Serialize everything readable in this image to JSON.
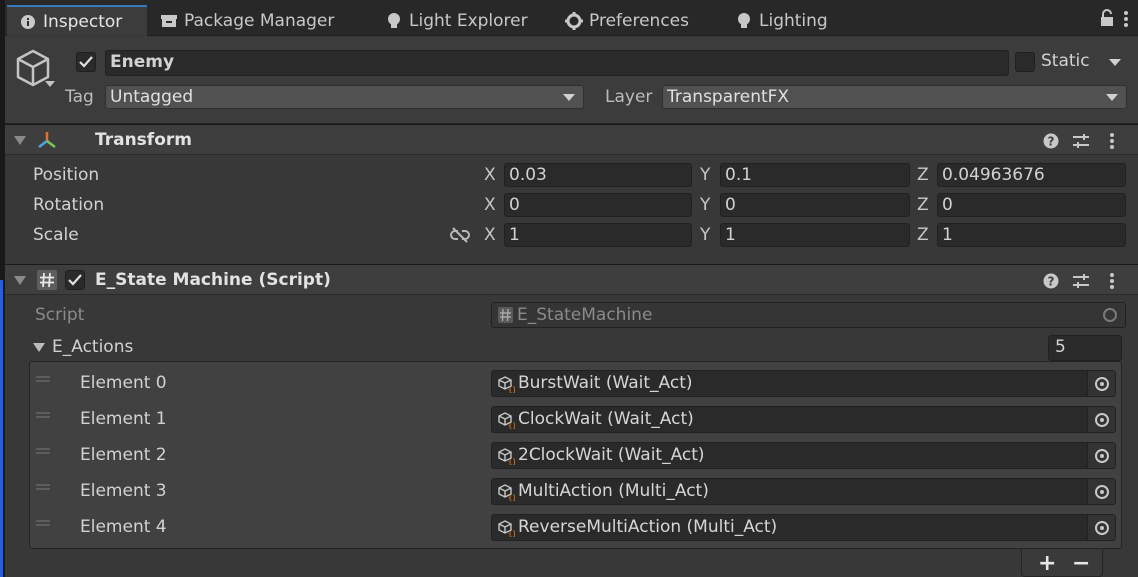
{
  "tabs": [
    {
      "label": "Inspector",
      "icon": "info-icon",
      "active": true
    },
    {
      "label": "Package Manager",
      "icon": "package-icon",
      "active": false
    },
    {
      "label": "Light Explorer",
      "icon": "lightbulb-icon",
      "active": false
    },
    {
      "label": "Preferences",
      "icon": "gear-icon",
      "active": false
    },
    {
      "label": "Lighting",
      "icon": "lightbulb-icon",
      "active": false
    }
  ],
  "gameobject": {
    "active": true,
    "name": "Enemy",
    "static_label": "Static",
    "static_checked": false,
    "tag_label": "Tag",
    "tag_value": "Untagged",
    "layer_label": "Layer",
    "layer_value": "TransparentFX"
  },
  "transform": {
    "title": "Transform",
    "position": {
      "label": "Position",
      "x": "0.03",
      "y": "0.1",
      "z": "0.04963676"
    },
    "rotation": {
      "label": "Rotation",
      "x": "0",
      "y": "0",
      "z": "0"
    },
    "scale": {
      "label": "Scale",
      "x": "1",
      "y": "1",
      "z": "1"
    },
    "axis_x": "X",
    "axis_y": "Y",
    "axis_z": "Z"
  },
  "script_component": {
    "enabled": true,
    "title": "E_State Machine (Script)",
    "script_label": "Script",
    "script_value": "E_StateMachine",
    "list_label": "E_Actions",
    "list_size": "5",
    "elements": [
      {
        "label": "Element 0",
        "value": "BurstWait (Wait_Act)"
      },
      {
        "label": "Element 1",
        "value": "ClockWait (Wait_Act)"
      },
      {
        "label": "Element 2",
        "value": "2ClockWait (Wait_Act)"
      },
      {
        "label": "Element 3",
        "value": "MultiAction (Multi_Act)"
      },
      {
        "label": "Element 4",
        "value": "ReverseMultiAction (Multi_Act)"
      }
    ],
    "add_label": "+",
    "remove_label": "−"
  },
  "colors": {
    "accent": "#3a79bb",
    "background": "#383838",
    "field": "#2a2a2a"
  }
}
